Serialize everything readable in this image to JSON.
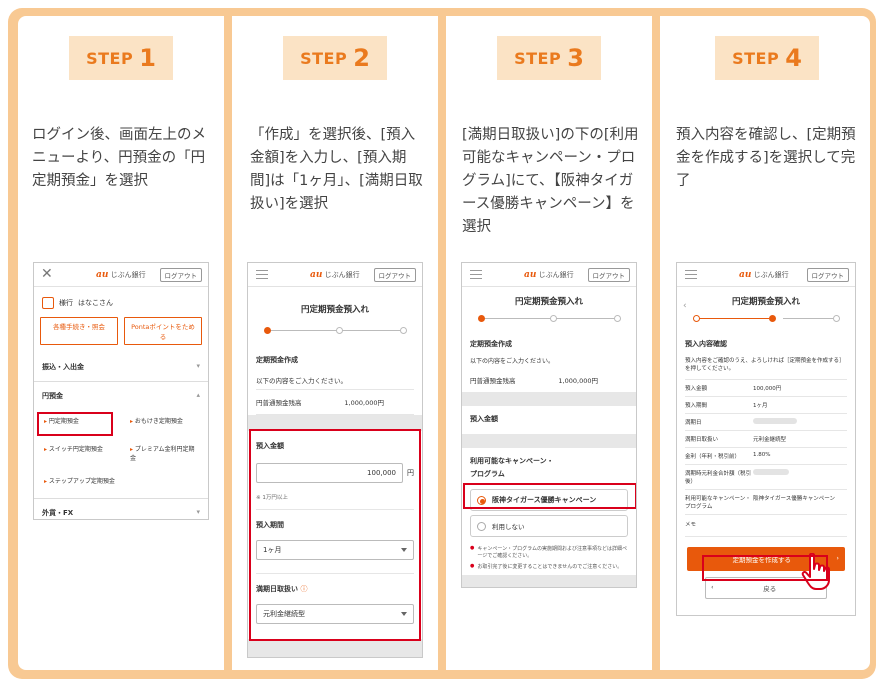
{
  "steps": [
    {
      "label": "STEP",
      "number": "1",
      "text": "ログイン後、画面左上のメニューより、円預金の「円定期預金」を選択",
      "screen": {
        "logout": "ログアウト",
        "user_prefix": "様行",
        "user_name": "はなこさん",
        "btn_procedures": "各種手続き・照会",
        "btn_ponta": "Pontaポイントをためる",
        "menu_transfer": "振込・入出金",
        "menu_yen": "円預金",
        "sub_teiki": "円定期預金",
        "sub_toku": "おもけき定期預金",
        "sub_switch": "スイッチ円定期預金",
        "sub_premium": "プレミアム金利円定期",
        "sub_premium_2": "金",
        "sub_stepup": "ステップアップ定期預金",
        "menu_fx": "外貨・FX"
      }
    },
    {
      "label": "STEP",
      "number": "2",
      "text": "「作成」を選択後、[預入金額]を入力し、[預入期間]は「1ヶ月」、[満期日取扱い]を選択",
      "screen": {
        "logout": "ログアウト",
        "title": "円定期預金預入れ",
        "section": "定期預金作成",
        "instruction": "以下の内容をご入力ください。",
        "balance_label": "円普通預金残高",
        "balance_value": "1,000,000円",
        "amount_label": "預入金額",
        "amount_value": "100,000",
        "amount_unit": "円",
        "amount_note": "※ 1万円以上",
        "period_label": "預入期間",
        "period_value": "1ヶ月",
        "maturity_label": "満期日取扱い",
        "maturity_value": "元利金継続型"
      }
    },
    {
      "label": "STEP",
      "number": "3",
      "text": "[満期日取扱い]の下の[利用可能なキャンペーン・プログラム]にて、【阪神タイガース優勝キャンペーン】を選択",
      "screen": {
        "logout": "ログアウト",
        "title": "円定期預金預入れ",
        "section": "定期預金作成",
        "instruction": "以下の内容をご入力ください。",
        "balance_label": "円普通預金残高",
        "balance_value": "1,000,000円",
        "amount_label": "預入金額",
        "campaign_label_1": "利用可能なキャンペーン・",
        "campaign_label_2": "プログラム",
        "opt_tigers": "阪神タイガース優勝キャンペーン",
        "opt_none": "利用しない",
        "note_1": "キャンペーン・プログラムの実施期間および注意事項などは詳細ページでご確認ください。",
        "note_2": "お取引完了後に変更することはできませんのでご注意ください。"
      }
    },
    {
      "label": "STEP",
      "number": "4",
      "text": "預入内容を確認し、[定期預金を作成する]を選択して完了",
      "screen": {
        "logout": "ログアウト",
        "title": "円定期預金預入れ",
        "confirm_heading": "預入内容確認",
        "confirm_text": "預入内容をご確認のうえ、よろしければ［定期預金を作成する］を押してください。",
        "r_amount_label": "預入金額",
        "r_amount_value": "100,000円",
        "r_period_label": "預入期間",
        "r_period_value": "1ヶ月",
        "r_maturity_date_label": "満期日",
        "r_handling_label": "満期日取扱い",
        "r_handling_value": "元利金継続型",
        "r_rate_label": "金利（年利・税引前）",
        "r_rate_value": "1.80%",
        "r_est_label": "満期時元利金合計額（税引後）",
        "r_campaign_label": "利用可能なキャンペーン・プログラム",
        "r_campaign_value": "阪神タイガース優勝キャンペーン",
        "r_memo_label": "メモ",
        "create_button": "定期預金を作成する",
        "back_button": "戻る"
      }
    }
  ],
  "logo_brand": "au",
  "logo_text": "じぶん銀行",
  "colors": {
    "frame": "#f8c993",
    "badge": "#fbe3c5",
    "accent": "#ea7a1e",
    "highlight": "#d9001b"
  }
}
